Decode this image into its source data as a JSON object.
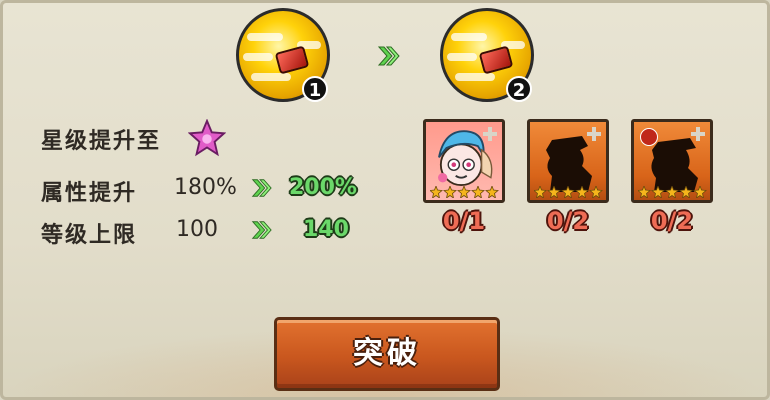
{
  "medals": [
    {
      "number": "1"
    },
    {
      "number": "2"
    }
  ],
  "star_upgrade": {
    "label": "星级提升至",
    "icon": "pink-star-icon"
  },
  "attributes": [
    {
      "label": "属性提升",
      "old": "180%",
      "new": "200%"
    },
    {
      "label": "等级上限",
      "old": "100",
      "new": "140"
    }
  ],
  "materials": [
    {
      "count": "0/1",
      "portrait": "hero-portrait"
    },
    {
      "count": "0/2",
      "portrait": "locked-silhouette"
    },
    {
      "count": "0/2",
      "portrait": "locked-silhouette-fire"
    }
  ],
  "button": {
    "label": "突破"
  },
  "colors": {
    "accent_green": "#6bd86a",
    "count_red": "#ee6c55",
    "button_orange": "#d2601f"
  }
}
